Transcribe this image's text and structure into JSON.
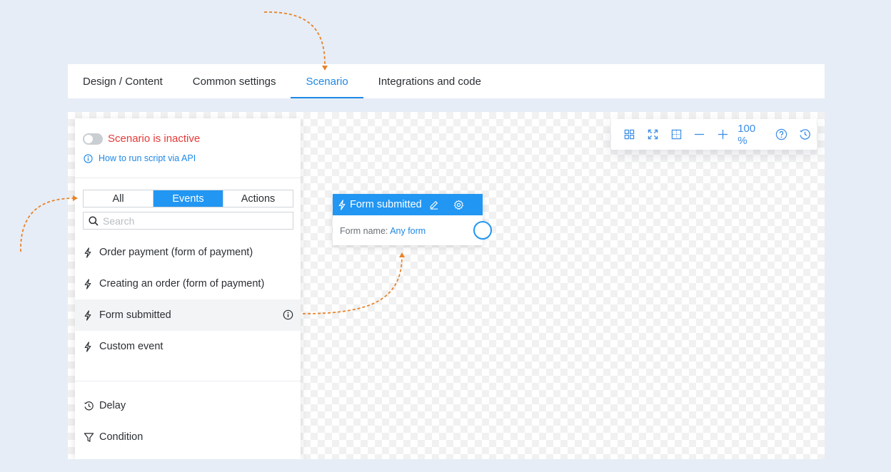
{
  "tabs": [
    {
      "label": "Design / Content"
    },
    {
      "label": "Common settings"
    },
    {
      "label": "Scenario"
    },
    {
      "label": "Integrations and code"
    }
  ],
  "panel": {
    "status_text": "Scenario is inactive",
    "api_link": "How to run script via API",
    "filters": [
      {
        "label": "All"
      },
      {
        "label": "Events"
      },
      {
        "label": "Actions"
      }
    ],
    "search_placeholder": "Search",
    "events": [
      {
        "label": "Order payment (form of payment)"
      },
      {
        "label": "Creating an order (form of payment)"
      },
      {
        "label": "Form submitted"
      },
      {
        "label": "Custom event"
      }
    ],
    "controls": [
      {
        "label": "Delay"
      },
      {
        "label": "Condition"
      }
    ]
  },
  "toolbar": {
    "zoom": "100 %"
  },
  "node": {
    "title": "Form submitted",
    "field_label": "Form name:",
    "field_value": "Any form"
  },
  "colors": {
    "accent": "#2196f3",
    "status_inactive": "#e53935",
    "annotation_arrow": "#e8832a",
    "page_bg": "#e6edf6"
  }
}
